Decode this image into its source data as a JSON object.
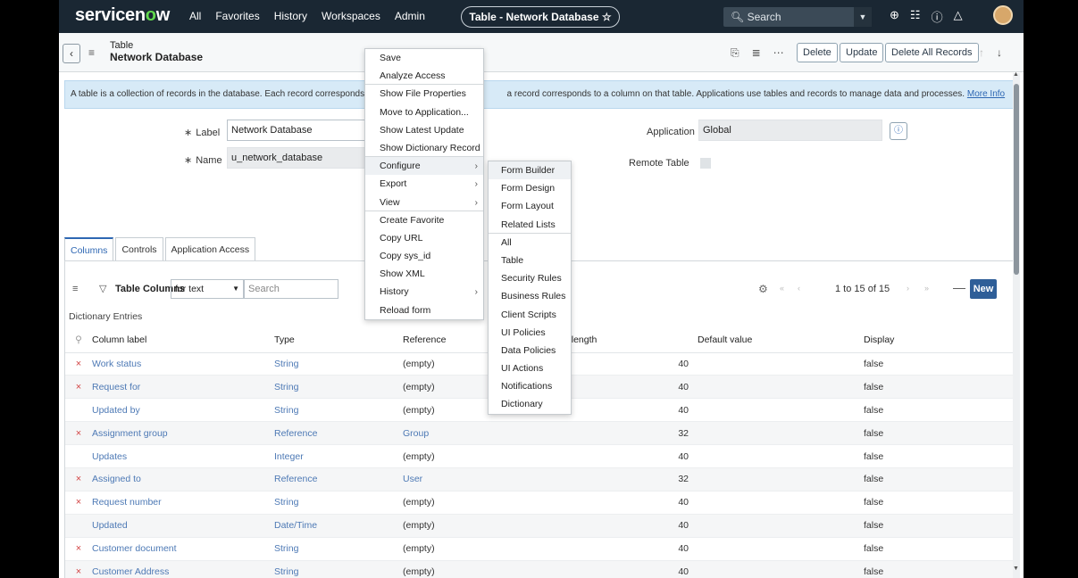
{
  "topnav": {
    "logo_a": "servicen",
    "logo_o": "o",
    "logo_b": "w",
    "links": [
      "All",
      "Favorites",
      "History",
      "Workspaces",
      "Admin"
    ],
    "context_title": "Table - Network Database ☆",
    "search_placeholder": "Search"
  },
  "header": {
    "line1": "Table",
    "line2": "Network Database",
    "buttons": {
      "delete": "Delete",
      "update": "Update",
      "delete_all": "Delete All Records"
    }
  },
  "info": {
    "text_a": "A table is a collection of records in the database. Each record corresponds to a",
    "text_b": "a record corresponds to a column on that table. Applications use tables and records to manage data and processes.",
    "more": "More Info"
  },
  "form": {
    "label_label": "Label",
    "label_value": "Network Database",
    "name_label": "Name",
    "name_value": "u_network_database",
    "application_label": "Application",
    "application_value": "Global",
    "remote_label": "Remote Table"
  },
  "tabs": [
    "Columns",
    "Controls",
    "Application Access"
  ],
  "list": {
    "title": "Table Columns",
    "filter_select": "for text",
    "search_placeholder": "Search",
    "pagination": "1 to 15 of 15",
    "new_label": "New",
    "section": "Dictionary Entries",
    "columns": [
      "Column label",
      "Type",
      "Reference",
      "Max length",
      "Default value",
      "Display"
    ],
    "rows": [
      {
        "x": "×",
        "label": "Work status",
        "type": "String",
        "ref": "(empty)",
        "max": "40",
        "display": "false"
      },
      {
        "x": "×",
        "label": "Request for",
        "type": "String",
        "ref": "(empty)",
        "max": "40",
        "display": "false"
      },
      {
        "x": "",
        "label": "Updated by",
        "type": "String",
        "ref": "(empty)",
        "max": "40",
        "display": "false"
      },
      {
        "x": "×",
        "label": "Assignment group",
        "type": "Reference",
        "ref": "Group",
        "max": "32",
        "display": "false"
      },
      {
        "x": "",
        "label": "Updates",
        "type": "Integer",
        "ref": "(empty)",
        "max": "40",
        "display": "false"
      },
      {
        "x": "×",
        "label": "Assigned to",
        "type": "Reference",
        "ref": "User",
        "max": "32",
        "display": "false"
      },
      {
        "x": "×",
        "label": "Request number",
        "type": "String",
        "ref": "(empty)",
        "max": "40",
        "display": "false"
      },
      {
        "x": "",
        "label": "Updated",
        "type": "Date/Time",
        "ref": "(empty)",
        "max": "40",
        "display": "false"
      },
      {
        "x": "×",
        "label": "Customer document",
        "type": "String",
        "ref": "(empty)",
        "max": "40",
        "display": "false"
      },
      {
        "x": "×",
        "label": "Customer Address",
        "type": "String",
        "ref": "(empty)",
        "max": "40",
        "display": "false"
      }
    ]
  },
  "context_menu": [
    {
      "label": "Save"
    },
    {
      "label": "Analyze Access"
    },
    {
      "label": "Show File Properties"
    },
    {
      "label": "Move to Application..."
    },
    {
      "label": "Show Latest Update"
    },
    {
      "label": "Show Dictionary Record"
    },
    {
      "label": "Configure",
      "arrow": "›",
      "highlight": true
    },
    {
      "label": "Export",
      "arrow": "›"
    },
    {
      "label": "View",
      "arrow": "›"
    },
    {
      "label": "Create Favorite"
    },
    {
      "label": "Copy URL"
    },
    {
      "label": "Copy sys_id"
    },
    {
      "label": "Show XML"
    },
    {
      "label": "History",
      "arrow": "›"
    },
    {
      "label": "Reload form"
    }
  ],
  "submenu": [
    "Form Builder",
    "Form Design",
    "Form Layout",
    "Related Lists",
    "All",
    "Table",
    "Security Rules",
    "Business Rules",
    "Client Scripts",
    "UI Policies",
    "Data Policies",
    "UI Actions",
    "Notifications",
    "Dictionary"
  ],
  "colors": {
    "nav": "#1a2733",
    "brand_green": "#62d84e",
    "primary": "#2e5e98",
    "link": "#4d79b5",
    "delete_x": "#d34444"
  }
}
